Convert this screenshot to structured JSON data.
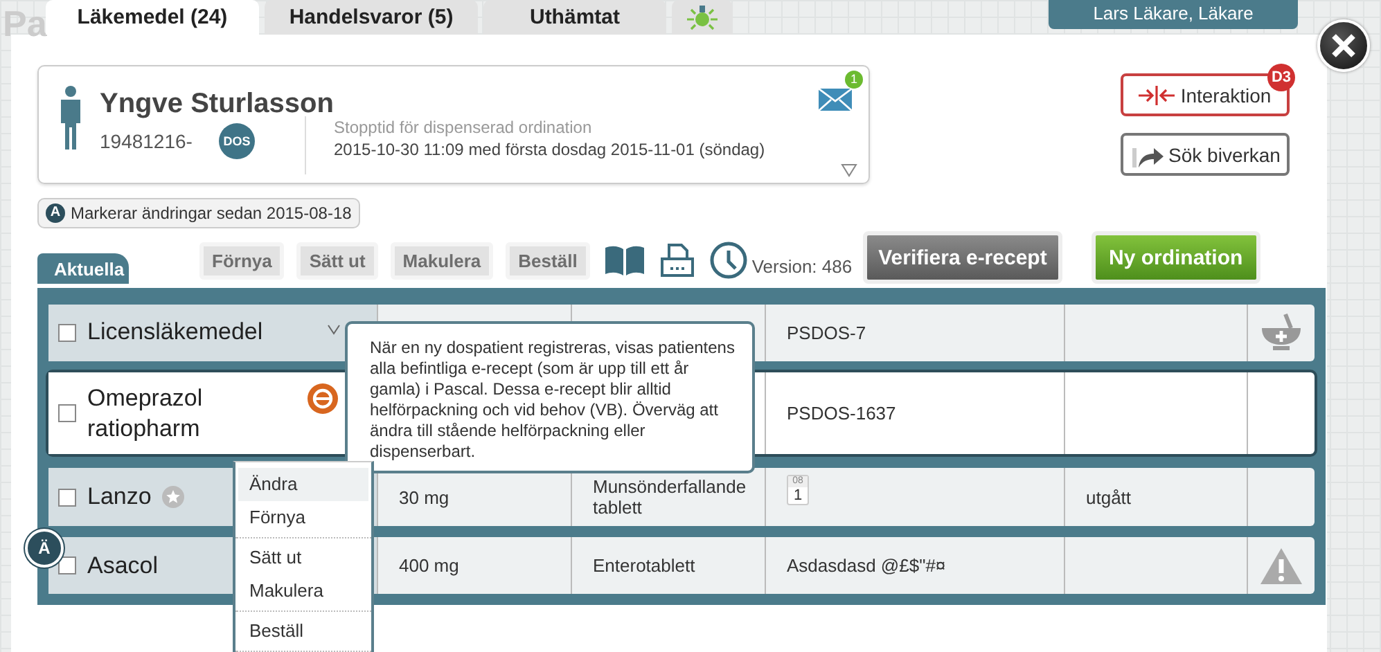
{
  "app_logo": "Pa",
  "tabs": [
    {
      "label": "Läkemedel (24)",
      "selected": true
    },
    {
      "label": "Handelsvaror (5)",
      "selected": false
    },
    {
      "label": "Uthämtat",
      "selected": false
    },
    {
      "kind": "lamp",
      "selected": false
    }
  ],
  "user": "Lars Läkare, Läkare",
  "patient": {
    "name": "Yngve Sturlasson",
    "id": "19481216-",
    "badge": "DOS",
    "stop_label": "Stopptid för dispenserad ordination",
    "stop_text": "2015-10-30 11:09 med första dosdag 2015-11-01 (söndag)",
    "mail_count": "1"
  },
  "side_buttons": [
    {
      "kind": "interaction",
      "label": "Interaktion",
      "badge": "D3"
    },
    {
      "kind": "side_effect",
      "label": "Sök biverkan"
    }
  ],
  "changes": {
    "badge": "A",
    "text": "Markerar ändringar sedan 2015-08-18"
  },
  "list_tab": "Aktuella",
  "actions": [
    {
      "label": "Förnya",
      "disabled": true
    },
    {
      "label": "Sätt ut",
      "disabled": true
    },
    {
      "label": "Makulera",
      "disabled": true
    },
    {
      "label": "Beställ",
      "disabled": true
    }
  ],
  "version": "Version: 486",
  "verify_button": "Verifiera e-recept",
  "new_button": "Ny ordination",
  "rows": [
    {
      "name": "Licensläkemedel",
      "checked": false,
      "selected": false,
      "name_icon": {
        "kind": "caret"
      },
      "code": "PSDOS-7",
      "end_icon": {
        "kind": "mortar"
      }
    },
    {
      "name": "Omeprazol ratiopharm",
      "checked": false,
      "selected": true,
      "name_icon": {
        "kind": "erecept"
      },
      "code": "PSDOS-1637"
    },
    {
      "name": "Lanzo",
      "checked": false,
      "selected": false,
      "name_icon": {
        "kind": "star"
      },
      "strength": "30 mg",
      "form": "Munsönderfallande tablett",
      "calendar": {
        "month": "08",
        "day": "1"
      },
      "status": "utgått"
    },
    {
      "name": "Asacol",
      "checked": false,
      "selected": false,
      "change_badge": "Ä",
      "strength": "400 mg",
      "form": "Enterotablett",
      "code": "Asdasdasd @£$\"#¤",
      "end_icon": {
        "kind": "warning"
      }
    }
  ],
  "tooltip": "När en ny dospatient registreras, visas patientens alla befintliga e-recept (som är upp till ett år gamla) i Pascal. Dessa e-recept blir alltid helförpackning och vid behov (VB).  Överväg att ändra till stående helförpackning eller dispenserbart.",
  "context_menu": [
    [
      {
        "label": "Ändra",
        "selected": true
      },
      {
        "label": "Förnya",
        "selected": false
      }
    ],
    [
      {
        "label": "Sätt ut",
        "selected": false
      },
      {
        "label": "Makulera",
        "selected": false
      }
    ],
    [
      {
        "label": "Beställ",
        "selected": false
      }
    ]
  ]
}
